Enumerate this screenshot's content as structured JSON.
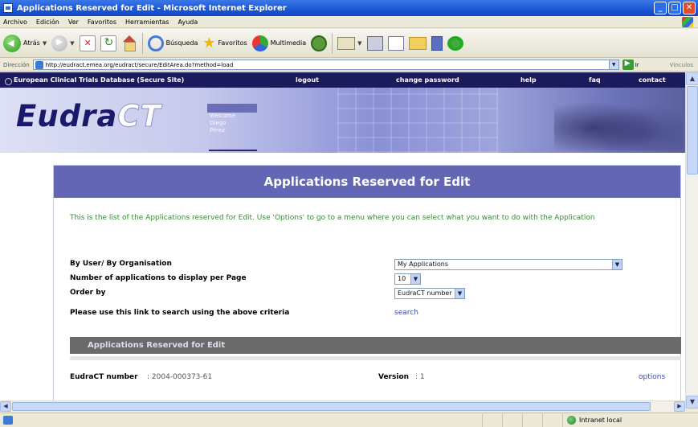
{
  "window": {
    "title": "Applications Reserved for Edit - Microsoft Internet Explorer"
  },
  "menu": [
    "Archivo",
    "Edición",
    "Ver",
    "Favoritos",
    "Herramientas",
    "Ayuda"
  ],
  "toolbar": {
    "back_label": "Atrás",
    "search_label": "Búsqueda",
    "favorites_label": "Favoritos",
    "media_label": "Multimedia"
  },
  "address": {
    "label": "Dirección",
    "url": "http://eudract.emea.org/eudract/secure/EditArea.do?method=load",
    "go_label": "Ir",
    "links_label": "Vínculos"
  },
  "site": {
    "nav_title": "European Clinical Trials Database (Secure Site)",
    "nav_links": [
      "logout",
      "change password",
      "help",
      "faq",
      "contact"
    ],
    "logo_part1": "Eudra",
    "logo_part2": "CT",
    "welcome_lines": [
      "Welcome",
      "Diego",
      "Pérez"
    ]
  },
  "panel": {
    "title": "Applications Reserved for Edit",
    "intro": "This is the list of the Applications reserved for Edit.  Use 'Options' to go to a menu where you can select what you want to do with the Application",
    "by_user_label": "By User/ By Organisation",
    "by_user_value": "My Applications",
    "per_page_label": "Number of applications to display per Page",
    "per_page_value": "10",
    "order_label": "Order by",
    "order_value": "EudraCT number",
    "search_hint": "Please use this link to search using the above criteria",
    "search_link": "search",
    "results_title": "Applications Reserved for Edit",
    "row": {
      "eudract_label": "EudraCT number",
      "eudract_value": ": 2004-000373-61",
      "version_label": "Version",
      "version_value": ": 1",
      "options_link": "options"
    }
  },
  "status": {
    "zone_label": "Intranet local"
  },
  "colors": {
    "panel_header": "#6366b4",
    "site_nav": "#1a1a5c",
    "intro_text": "#3a8a3a",
    "link": "#3a4ab0"
  }
}
